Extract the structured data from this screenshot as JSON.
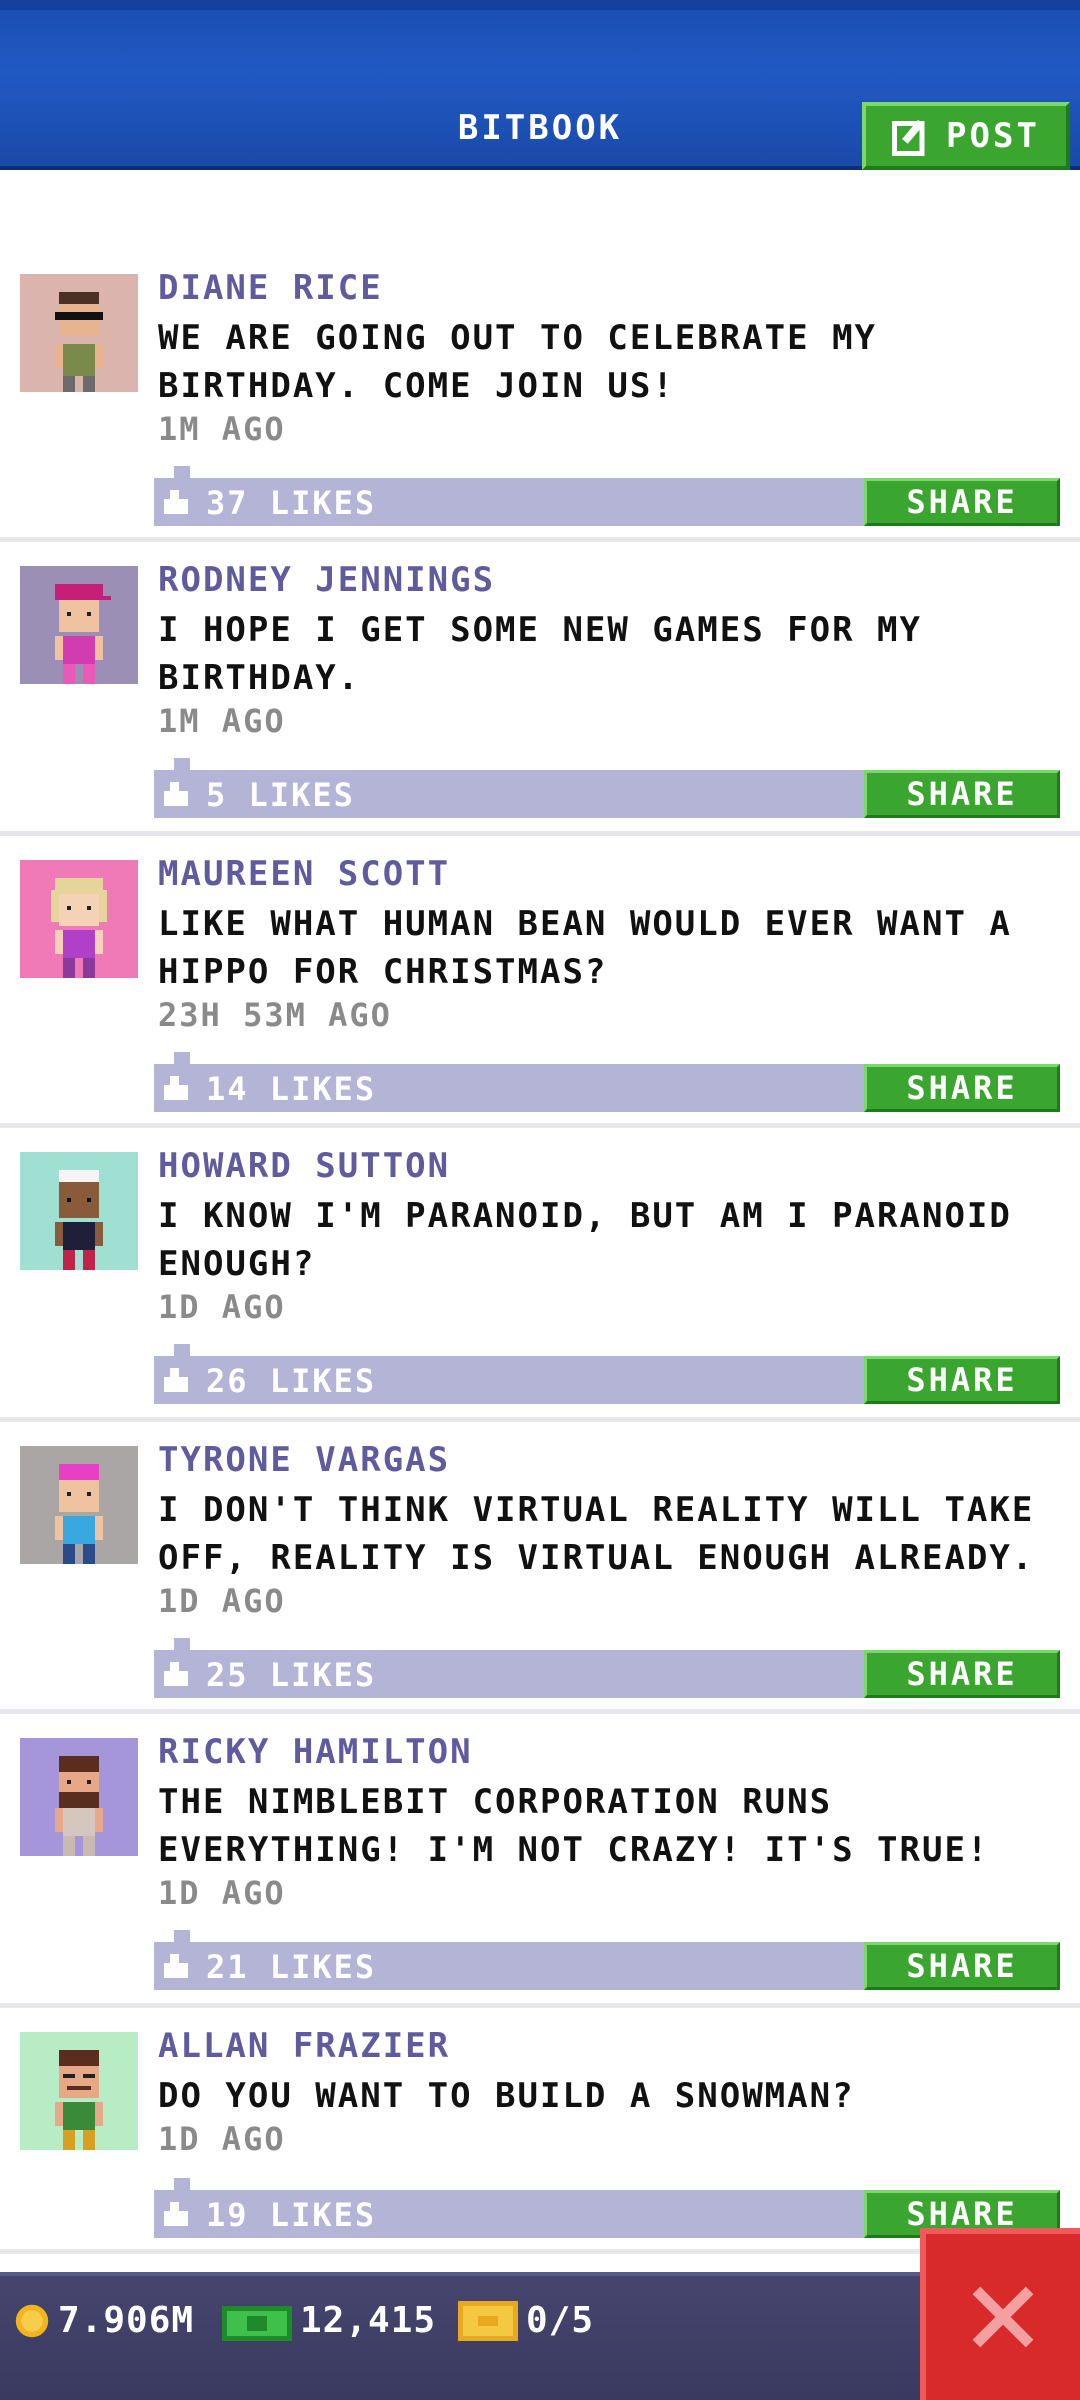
{
  "header": {
    "title": "BITBOOK",
    "post_label": "POST"
  },
  "posts": [
    {
      "author": "DIANE RICE",
      "message": "WE ARE GOING OUT TO CELEBRATE MY BIRTHDAY. COME JOIN US!",
      "time": "1M AGO",
      "likes": "37 LIKES",
      "share_label": "SHARE",
      "avatar_bg": "#dcb4ae"
    },
    {
      "author": "RODNEY JENNINGS",
      "message": "I HOPE I GET SOME NEW GAMES FOR MY BIRTHDAY.",
      "time": "1M AGO",
      "likes": "5 LIKES",
      "share_label": "SHARE",
      "avatar_bg": "#9c8fb6"
    },
    {
      "author": "MAUREEN SCOTT",
      "message": "LIKE WHAT HUMAN BEAN WOULD EVER WANT A HIPPO FOR CHRISTMAS?",
      "time": "23H 53M AGO",
      "likes": "14 LIKES",
      "share_label": "SHARE",
      "avatar_bg": "#f07ab8"
    },
    {
      "author": "HOWARD SUTTON",
      "message": "I KNOW I'M PARANOID, BUT AM I PARANOID ENOUGH?",
      "time": "1D AGO",
      "likes": "26 LIKES",
      "share_label": "SHARE",
      "avatar_bg": "#9fe0d2"
    },
    {
      "author": "TYRONE VARGAS",
      "message": "I DON'T THINK VIRTUAL REALITY WILL TAKE OFF, REALITY IS VIRTUAL ENOUGH ALREADY.",
      "time": "1D AGO",
      "likes": "25 LIKES",
      "share_label": "SHARE",
      "avatar_bg": "#aaa6a6"
    },
    {
      "author": "RICKY HAMILTON",
      "message": "THE NIMBLEBIT CORPORATION RUNS EVERYTHING! I'M NOT CRAZY! IT'S TRUE!",
      "time": "1D AGO",
      "likes": "21 LIKES",
      "share_label": "SHARE",
      "avatar_bg": "#a596dc"
    },
    {
      "author": "ALLAN FRAZIER",
      "message": "DO YOU WANT TO BUILD A SNOWMAN?",
      "time": "1D AGO",
      "likes": "19 LIKES",
      "share_label": "SHARE",
      "avatar_bg": "#b8ecc4"
    }
  ],
  "footer": {
    "coins": "7.906M",
    "bux": "12,415",
    "tickets": "0/5"
  }
}
